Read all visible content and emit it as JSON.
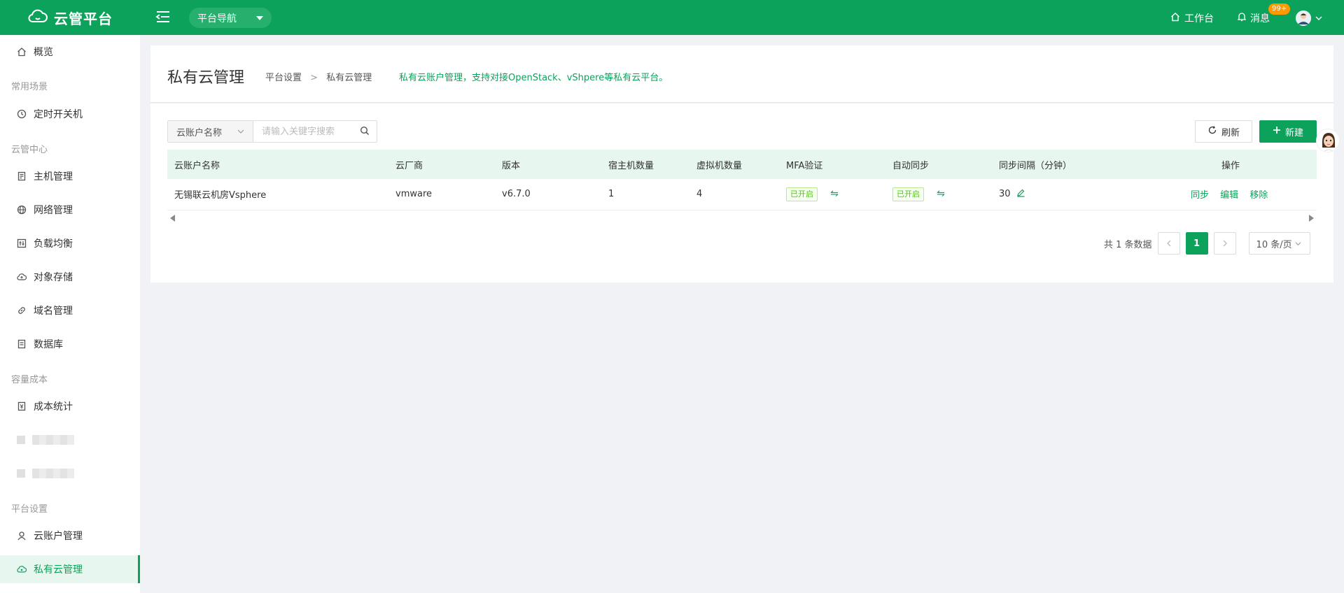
{
  "topbar": {
    "logo_text": "云管平台",
    "platform_nav": "平台导航",
    "workbench": "工作台",
    "messages": "消息",
    "badge": "99+"
  },
  "sidebar": {
    "overview": "概览",
    "group_common": "常用场景",
    "scheduled_power": "定时开关机",
    "group_cloud": "云管中心",
    "host_mgmt": "主机管理",
    "network_mgmt": "网络管理",
    "load_balance": "负载均衡",
    "object_storage": "对象存储",
    "domain_mgmt": "域名管理",
    "database": "数据库",
    "group_cost": "容量成本",
    "cost_stats": "成本统计",
    "group_platform": "平台设置",
    "cloud_account": "云账户管理",
    "private_cloud": "私有云管理"
  },
  "header": {
    "title": "私有云管理",
    "breadcrumb_parent": "平台设置",
    "breadcrumb_sep": ">",
    "breadcrumb_current": "私有云管理",
    "description": "私有云账户管理，支持对接OpenStack、vShpere等私有云平台。"
  },
  "toolbar": {
    "search_field": "云账户名称",
    "search_placeholder": "请输入关键字搜索",
    "refresh_label": "刷新",
    "new_label": "新建"
  },
  "table": {
    "columns": [
      "云账户名称",
      "云厂商",
      "版本",
      "宿主机数量",
      "虚拟机数量",
      "MFA验证",
      "自动同步",
      "同步间隔（分钟）",
      "操作"
    ],
    "rows": [
      {
        "name": "无锡联云机房Vsphere",
        "vendor": "vmware",
        "version": "v6.7.0",
        "hosts": "1",
        "vms": "4",
        "mfa": "已开启",
        "auto_sync": "已开启",
        "interval": "30",
        "op_sync": "同步",
        "op_edit": "编辑",
        "op_remove": "移除"
      }
    ]
  },
  "pagination": {
    "total": "共 1 条数据",
    "current_page": "1",
    "page_size": "10 条/页"
  },
  "colors": {
    "brand": "#0da25b",
    "brand_light": "#e7f6ee"
  }
}
